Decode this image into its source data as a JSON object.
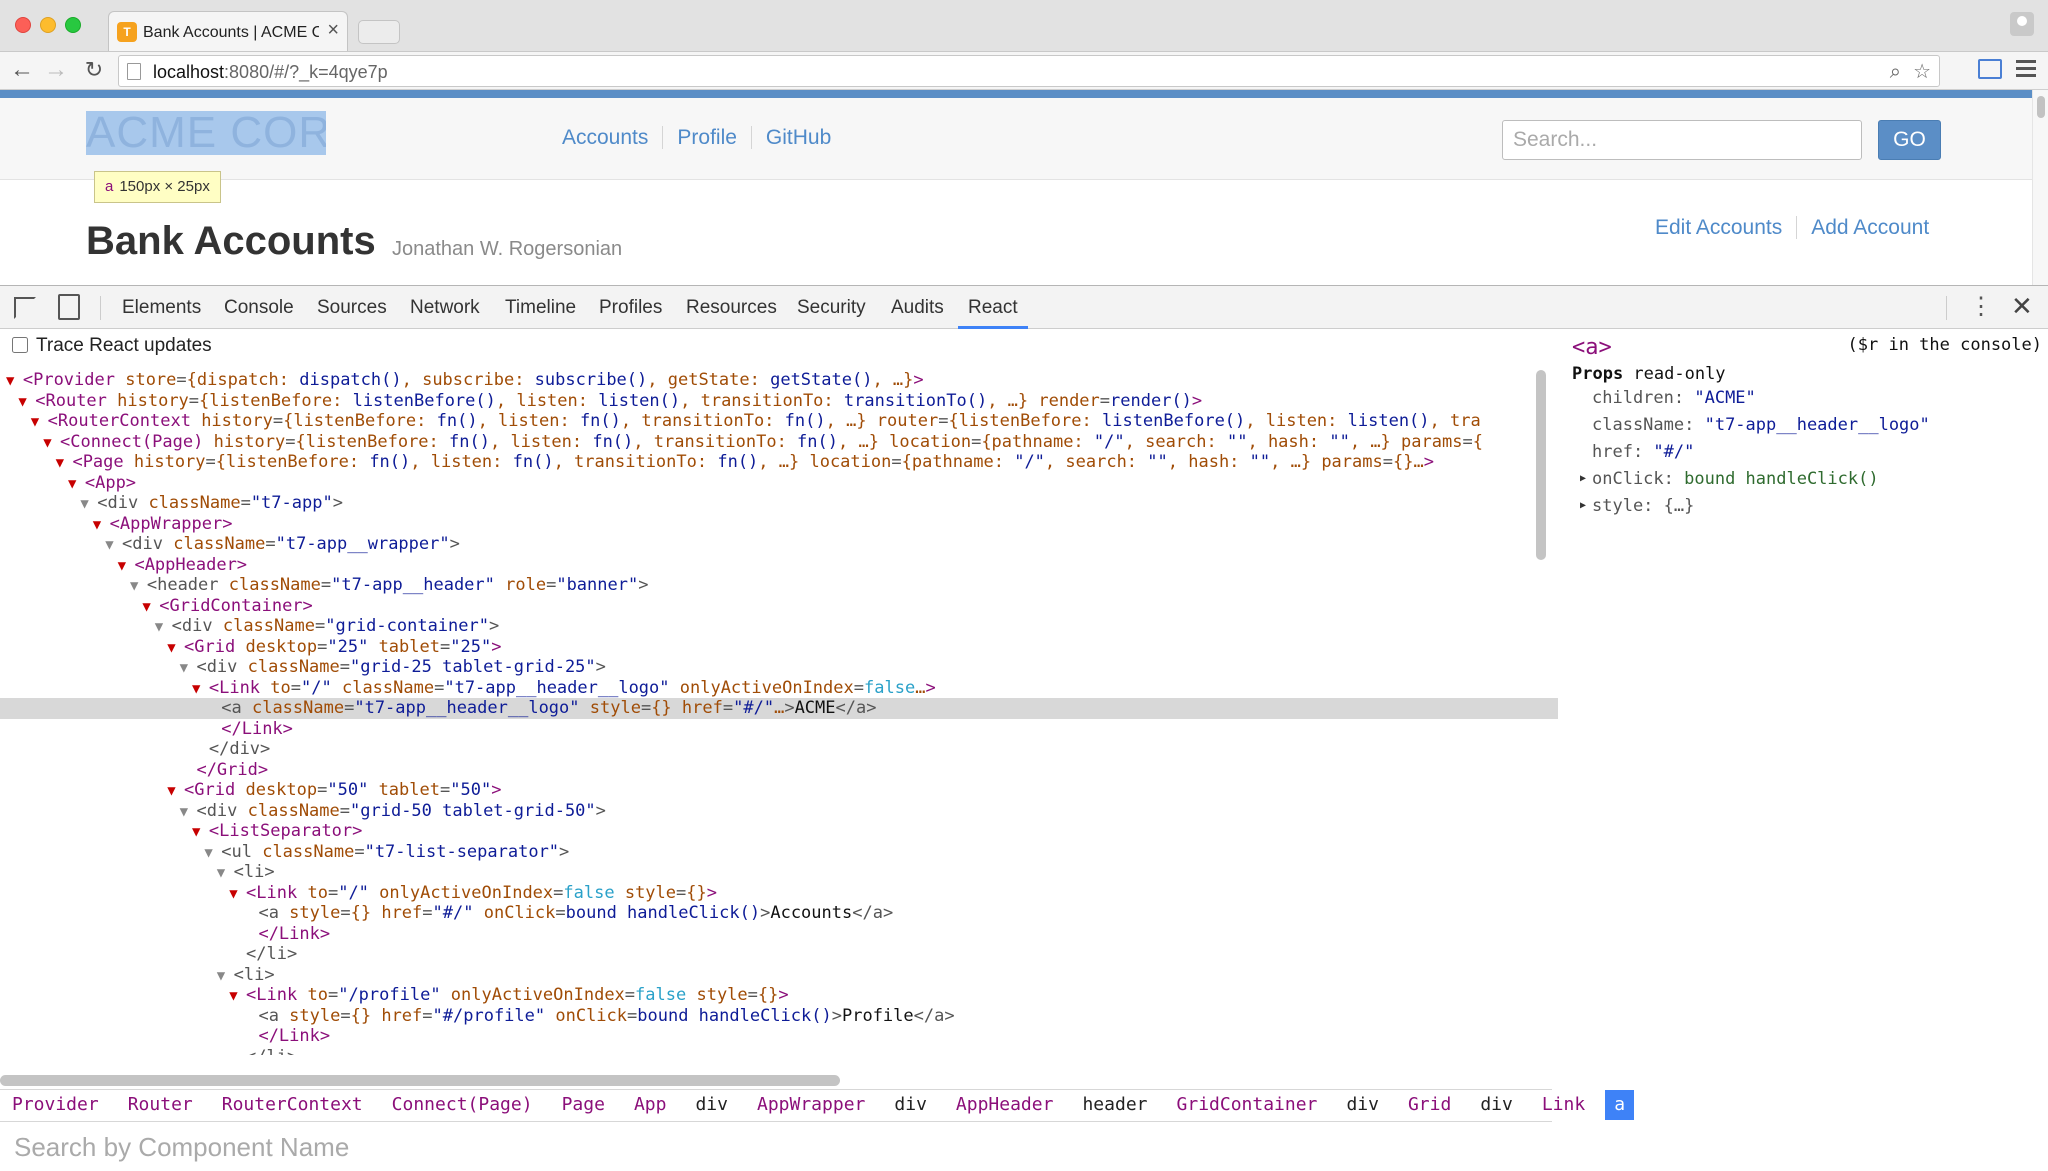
{
  "browser": {
    "tab_title": "Bank Accounts | ACME Cor",
    "tab_close": "×",
    "url_host": "localhost",
    "url_path": ":8080/#/?_k=4qye7p"
  },
  "site": {
    "logo_text": "ACME CORP",
    "logo_tooltip_tag": "a",
    "logo_tooltip_size": "150px × 25px",
    "nav": [
      "Accounts",
      "Profile",
      "GitHub"
    ],
    "search_placeholder": "Search...",
    "go_label": "GO",
    "page_title": "Bank Accounts",
    "page_subtitle": "Jonathan W. Rogersonian",
    "actions": [
      "Edit Accounts",
      "Add Account"
    ]
  },
  "devtools": {
    "tabs": [
      "Elements",
      "Console",
      "Sources",
      "Network",
      "Timeline",
      "Profiles",
      "Resources",
      "Security",
      "Audits",
      "React"
    ],
    "active_tab": "React",
    "trace_label": "Trace React updates",
    "breadcrumbs": [
      "Provider",
      "Router",
      "RouterContext",
      "Connect(Page)",
      "Page",
      "App",
      "div",
      "AppWrapper",
      "div",
      "AppHeader",
      "header",
      "GridContainer",
      "div",
      "Grid",
      "div",
      "Link",
      "a"
    ],
    "search_placeholder": "Search by Component Name",
    "tree": [
      {
        "indent": 0,
        "arrow": "▼",
        "segs": [
          [
            "tag",
            "<Provider "
          ],
          [
            "attr",
            "store"
          ],
          [
            "dom",
            "="
          ],
          [
            "attr",
            "{dispatch: "
          ],
          [
            "val",
            "dispatch()"
          ],
          [
            "attr",
            ", subscribe: "
          ],
          [
            "val",
            "subscribe()"
          ],
          [
            "attr",
            ", getState: "
          ],
          [
            "val",
            "getState()"
          ],
          [
            "attr",
            ", …}"
          ],
          [
            "tag",
            ">"
          ]
        ]
      },
      {
        "indent": 1,
        "arrow": "▼",
        "segs": [
          [
            "tag",
            "<Router "
          ],
          [
            "attr",
            "history"
          ],
          [
            "dom",
            "="
          ],
          [
            "attr",
            "{listenBefore: "
          ],
          [
            "val",
            "listenBefore()"
          ],
          [
            "attr",
            ", listen: "
          ],
          [
            "val",
            "listen()"
          ],
          [
            "attr",
            ", transitionTo: "
          ],
          [
            "val",
            "transitionTo()"
          ],
          [
            "attr",
            ", …} render"
          ],
          [
            "dom",
            "="
          ],
          [
            "val",
            "render()"
          ],
          [
            "tag",
            ">"
          ]
        ]
      },
      {
        "indent": 2,
        "arrow": "▼",
        "segs": [
          [
            "tag",
            "<RouterContext "
          ],
          [
            "attr",
            "history"
          ],
          [
            "dom",
            "="
          ],
          [
            "attr",
            "{listenBefore: "
          ],
          [
            "val",
            "fn()"
          ],
          [
            "attr",
            ", listen: "
          ],
          [
            "val",
            "fn()"
          ],
          [
            "attr",
            ", transitionTo: "
          ],
          [
            "val",
            "fn()"
          ],
          [
            "attr",
            ", …} router"
          ],
          [
            "dom",
            "="
          ],
          [
            "attr",
            "{listenBefore: "
          ],
          [
            "val",
            "listenBefore()"
          ],
          [
            "attr",
            ", listen: "
          ],
          [
            "val",
            "listen()"
          ],
          [
            "attr",
            ", tra"
          ]
        ]
      },
      {
        "indent": 3,
        "arrow": "▼",
        "segs": [
          [
            "tag",
            "<Connect(Page) "
          ],
          [
            "attr",
            "history"
          ],
          [
            "dom",
            "="
          ],
          [
            "attr",
            "{listenBefore: "
          ],
          [
            "val",
            "fn()"
          ],
          [
            "attr",
            ", listen: "
          ],
          [
            "val",
            "fn()"
          ],
          [
            "attr",
            ", transitionTo: "
          ],
          [
            "val",
            "fn()"
          ],
          [
            "attr",
            ", …} location"
          ],
          [
            "dom",
            "="
          ],
          [
            "attr",
            "{pathname: "
          ],
          [
            "val",
            "\"/\""
          ],
          [
            "attr",
            ", search: "
          ],
          [
            "val",
            "\"\""
          ],
          [
            "attr",
            ", hash: "
          ],
          [
            "val",
            "\"\""
          ],
          [
            "attr",
            ", …} params"
          ],
          [
            "dom",
            "="
          ],
          [
            "attr",
            "{"
          ]
        ]
      },
      {
        "indent": 4,
        "arrow": "▼",
        "segs": [
          [
            "tag",
            "<Page "
          ],
          [
            "attr",
            "history"
          ],
          [
            "dom",
            "="
          ],
          [
            "attr",
            "{listenBefore: "
          ],
          [
            "val",
            "fn()"
          ],
          [
            "attr",
            ", listen: "
          ],
          [
            "val",
            "fn()"
          ],
          [
            "attr",
            ", transitionTo: "
          ],
          [
            "val",
            "fn()"
          ],
          [
            "attr",
            ", …} location"
          ],
          [
            "dom",
            "="
          ],
          [
            "attr",
            "{pathname: "
          ],
          [
            "val",
            "\"/\""
          ],
          [
            "attr",
            ", search: "
          ],
          [
            "val",
            "\"\""
          ],
          [
            "attr",
            ", hash: "
          ],
          [
            "val",
            "\"\""
          ],
          [
            "attr",
            ", …} params"
          ],
          [
            "dom",
            "="
          ],
          [
            "attr",
            "{}…"
          ],
          [
            "tag",
            ">"
          ]
        ]
      },
      {
        "indent": 5,
        "arrow": "▼",
        "segs": [
          [
            "tag",
            "<App>"
          ]
        ]
      },
      {
        "indent": 6,
        "arrow": "▼",
        "gray": true,
        "segs": [
          [
            "dom",
            "<div "
          ],
          [
            "attr",
            "className"
          ],
          [
            "dom",
            "="
          ],
          [
            "val",
            "\"t7-app\""
          ],
          [
            "dom",
            ">"
          ]
        ]
      },
      {
        "indent": 7,
        "arrow": "▼",
        "segs": [
          [
            "tag",
            "<AppWrapper>"
          ]
        ]
      },
      {
        "indent": 8,
        "arrow": "▼",
        "gray": true,
        "segs": [
          [
            "dom",
            "<div "
          ],
          [
            "attr",
            "className"
          ],
          [
            "dom",
            "="
          ],
          [
            "val",
            "\"t7-app__wrapper\""
          ],
          [
            "dom",
            ">"
          ]
        ]
      },
      {
        "indent": 9,
        "arrow": "▼",
        "segs": [
          [
            "tag",
            "<AppHeader>"
          ]
        ]
      },
      {
        "indent": 10,
        "arrow": "▼",
        "gray": true,
        "segs": [
          [
            "dom",
            "<header "
          ],
          [
            "attr",
            "className"
          ],
          [
            "dom",
            "="
          ],
          [
            "val",
            "\"t7-app__header\""
          ],
          [
            "attr",
            " role"
          ],
          [
            "dom",
            "="
          ],
          [
            "val",
            "\"banner\""
          ],
          [
            "dom",
            ">"
          ]
        ]
      },
      {
        "indent": 11,
        "arrow": "▼",
        "segs": [
          [
            "tag",
            "<GridContainer>"
          ]
        ]
      },
      {
        "indent": 12,
        "arrow": "▼",
        "gray": true,
        "segs": [
          [
            "dom",
            "<div "
          ],
          [
            "attr",
            "className"
          ],
          [
            "dom",
            "="
          ],
          [
            "val",
            "\"grid-container\""
          ],
          [
            "dom",
            ">"
          ]
        ]
      },
      {
        "indent": 13,
        "arrow": "▼",
        "segs": [
          [
            "tag",
            "<Grid "
          ],
          [
            "attr",
            "desktop"
          ],
          [
            "dom",
            "="
          ],
          [
            "val",
            "\"25\""
          ],
          [
            "attr",
            " tablet"
          ],
          [
            "dom",
            "="
          ],
          [
            "val",
            "\"25\""
          ],
          [
            "tag",
            ">"
          ]
        ]
      },
      {
        "indent": 14,
        "arrow": "▼",
        "gray": true,
        "segs": [
          [
            "dom",
            "<div "
          ],
          [
            "attr",
            "className"
          ],
          [
            "dom",
            "="
          ],
          [
            "val",
            "\"grid-25 tablet-grid-25\""
          ],
          [
            "dom",
            ">"
          ]
        ]
      },
      {
        "indent": 15,
        "arrow": "▼",
        "segs": [
          [
            "tag",
            "<Link "
          ],
          [
            "attr",
            "to"
          ],
          [
            "dom",
            "="
          ],
          [
            "val",
            "\"/\""
          ],
          [
            "attr",
            " className"
          ],
          [
            "dom",
            "="
          ],
          [
            "val",
            "\"t7-app__header__logo\""
          ],
          [
            "attr",
            " onlyActiveOnIndex"
          ],
          [
            "dom",
            "="
          ],
          [
            "bool",
            "false"
          ],
          [
            "attr",
            "…"
          ],
          [
            "tag",
            ">"
          ]
        ]
      },
      {
        "indent": 16,
        "arrow": "",
        "selected": true,
        "segs": [
          [
            "dom",
            "<a "
          ],
          [
            "attr",
            "className"
          ],
          [
            "dom",
            "="
          ],
          [
            "val",
            "\"t7-app__header__logo\""
          ],
          [
            "attr",
            " style"
          ],
          [
            "dom",
            "="
          ],
          [
            "attr",
            "{}"
          ],
          [
            "attr",
            " href"
          ],
          [
            "dom",
            "="
          ],
          [
            "val",
            "\"#/\""
          ],
          [
            "attr",
            "…"
          ],
          [
            "dom",
            ">"
          ],
          [
            "text",
            "ACME"
          ],
          [
            "dom",
            "</a>"
          ]
        ]
      },
      {
        "indent": 16,
        "arrow": "",
        "segs": [
          [
            "tag",
            "</Link>"
          ]
        ]
      },
      {
        "indent": 15,
        "arrow": "",
        "segs": [
          [
            "dom",
            "</div>"
          ]
        ]
      },
      {
        "indent": 14,
        "arrow": "",
        "segs": [
          [
            "tag",
            "</Grid>"
          ]
        ]
      },
      {
        "indent": 13,
        "arrow": "▼",
        "segs": [
          [
            "tag",
            "<Grid "
          ],
          [
            "attr",
            "desktop"
          ],
          [
            "dom",
            "="
          ],
          [
            "val",
            "\"50\""
          ],
          [
            "attr",
            " tablet"
          ],
          [
            "dom",
            "="
          ],
          [
            "val",
            "\"50\""
          ],
          [
            "tag",
            ">"
          ]
        ]
      },
      {
        "indent": 14,
        "arrow": "▼",
        "gray": true,
        "segs": [
          [
            "dom",
            "<div "
          ],
          [
            "attr",
            "className"
          ],
          [
            "dom",
            "="
          ],
          [
            "val",
            "\"grid-50 tablet-grid-50\""
          ],
          [
            "dom",
            ">"
          ]
        ]
      },
      {
        "indent": 15,
        "arrow": "▼",
        "segs": [
          [
            "tag",
            "<ListSeparator>"
          ]
        ]
      },
      {
        "indent": 16,
        "arrow": "▼",
        "gray": true,
        "segs": [
          [
            "dom",
            "<ul "
          ],
          [
            "attr",
            "className"
          ],
          [
            "dom",
            "="
          ],
          [
            "val",
            "\"t7-list-separator\""
          ],
          [
            "dom",
            ">"
          ]
        ]
      },
      {
        "indent": 17,
        "arrow": "▼",
        "gray": true,
        "segs": [
          [
            "dom",
            "<li>"
          ]
        ]
      },
      {
        "indent": 18,
        "arrow": "▼",
        "segs": [
          [
            "tag",
            "<Link "
          ],
          [
            "attr",
            "to"
          ],
          [
            "dom",
            "="
          ],
          [
            "val",
            "\"/\""
          ],
          [
            "attr",
            " onlyActiveOnIndex"
          ],
          [
            "dom",
            "="
          ],
          [
            "bool",
            "false"
          ],
          [
            "attr",
            " style"
          ],
          [
            "dom",
            "="
          ],
          [
            "attr",
            "{}"
          ],
          [
            "tag",
            ">"
          ]
        ]
      },
      {
        "indent": 19,
        "arrow": "",
        "segs": [
          [
            "dom",
            "<a "
          ],
          [
            "attr",
            "style"
          ],
          [
            "dom",
            "="
          ],
          [
            "attr",
            "{}"
          ],
          [
            "attr",
            " href"
          ],
          [
            "dom",
            "="
          ],
          [
            "val",
            "\"#/\""
          ],
          [
            "attr",
            " onClick"
          ],
          [
            "dom",
            "="
          ],
          [
            "val",
            "bound handleClick()"
          ],
          [
            "dom",
            ">"
          ],
          [
            "text",
            "Accounts"
          ],
          [
            "dom",
            "</a>"
          ]
        ]
      },
      {
        "indent": 19,
        "arrow": "",
        "segs": [
          [
            "tag",
            "</Link>"
          ]
        ]
      },
      {
        "indent": 18,
        "arrow": "",
        "segs": [
          [
            "dom",
            "</li>"
          ]
        ]
      },
      {
        "indent": 17,
        "arrow": "▼",
        "gray": true,
        "segs": [
          [
            "dom",
            "<li>"
          ]
        ]
      },
      {
        "indent": 18,
        "arrow": "▼",
        "segs": [
          [
            "tag",
            "<Link "
          ],
          [
            "attr",
            "to"
          ],
          [
            "dom",
            "="
          ],
          [
            "val",
            "\"/profile\""
          ],
          [
            "attr",
            " onlyActiveOnIndex"
          ],
          [
            "dom",
            "="
          ],
          [
            "bool",
            "false"
          ],
          [
            "attr",
            " style"
          ],
          [
            "dom",
            "="
          ],
          [
            "attr",
            "{}"
          ],
          [
            "tag",
            ">"
          ]
        ]
      },
      {
        "indent": 19,
        "arrow": "",
        "segs": [
          [
            "dom",
            "<a "
          ],
          [
            "attr",
            "style"
          ],
          [
            "dom",
            "="
          ],
          [
            "attr",
            "{}"
          ],
          [
            "attr",
            " href"
          ],
          [
            "dom",
            "="
          ],
          [
            "val",
            "\"#/profile\""
          ],
          [
            "attr",
            " onClick"
          ],
          [
            "dom",
            "="
          ],
          [
            "val",
            "bound handleClick()"
          ],
          [
            "dom",
            ">"
          ],
          [
            "text",
            "Profile"
          ],
          [
            "dom",
            "</a>"
          ]
        ]
      },
      {
        "indent": 19,
        "arrow": "",
        "segs": [
          [
            "tag",
            "</Link>"
          ]
        ]
      },
      {
        "indent": 18,
        "arrow": "",
        "segs": [
          [
            "dom",
            "</li>"
          ]
        ]
      }
    ],
    "props": {
      "header": "<a>",
      "console_hint": "($r in the console)",
      "title_bold": "Props",
      "title_rest": " read-only",
      "items": [
        {
          "key": "children: ",
          "value": "\"ACME\"",
          "type": "str"
        },
        {
          "key": "className: ",
          "value": "\"t7-app__header__logo\"",
          "type": "str"
        },
        {
          "key": "href: ",
          "value": "\"#/\"",
          "type": "str"
        },
        {
          "key": "onClick: ",
          "value": "bound handleClick()",
          "type": "fn",
          "expandable": true
        },
        {
          "key": "style: ",
          "value": "{…}",
          "type": "obj",
          "expandable": true
        }
      ]
    }
  }
}
